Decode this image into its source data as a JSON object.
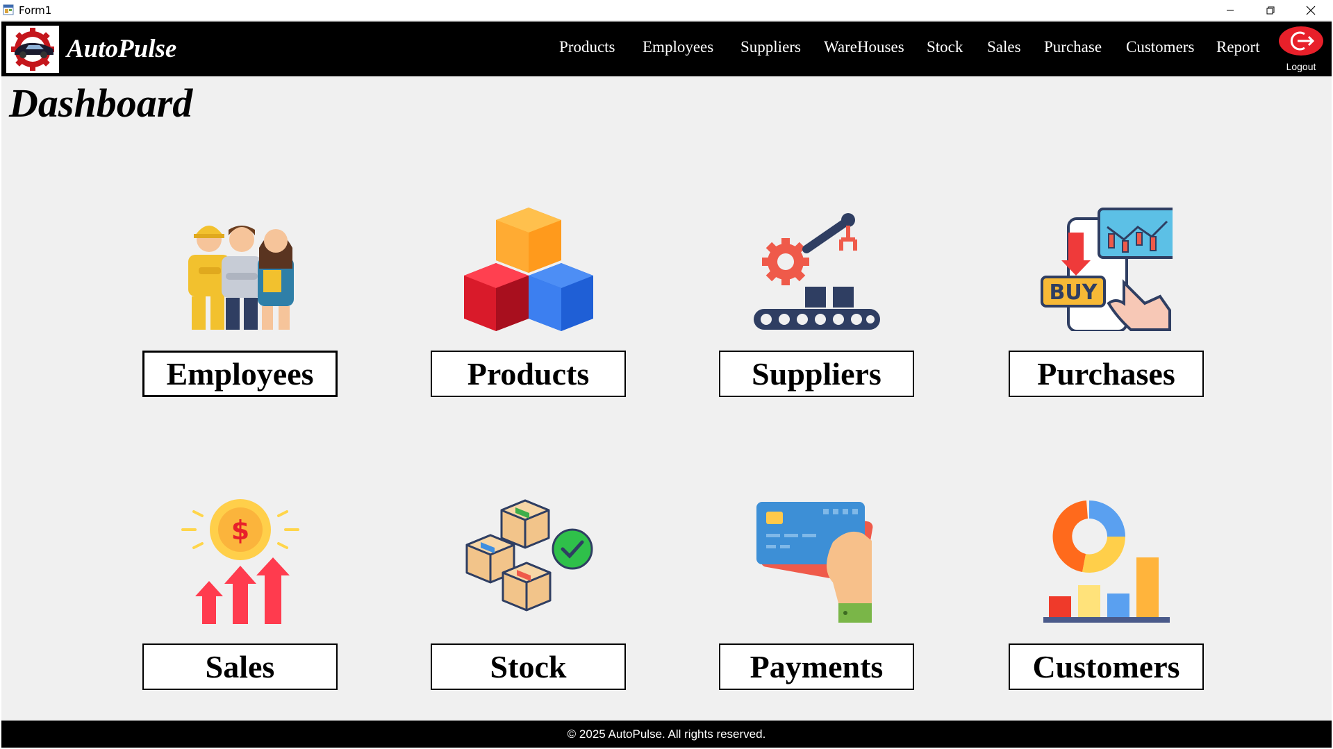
{
  "window": {
    "title": "Form1"
  },
  "navbar": {
    "brand": "AutoPulse",
    "links": [
      "Products",
      "Employees",
      "Suppliers",
      "WareHouses",
      "Stock",
      "Sales",
      "Purchase",
      "Customers",
      "Report"
    ],
    "logout_label": "Logout"
  },
  "page": {
    "title": "Dashboard"
  },
  "tiles": [
    {
      "label": "Employees",
      "icon": "employees-icon"
    },
    {
      "label": "Products",
      "icon": "products-cubes-icon"
    },
    {
      "label": "Suppliers",
      "icon": "suppliers-factory-icon"
    },
    {
      "label": "Purchases",
      "icon": "purchases-buy-icon"
    },
    {
      "label": "Sales",
      "icon": "sales-dollar-arrows-icon"
    },
    {
      "label": "Stock",
      "icon": "stock-boxes-icon"
    },
    {
      "label": "Payments",
      "icon": "payments-card-icon"
    },
    {
      "label": "Customers",
      "icon": "customers-chart-icon"
    }
  ],
  "footer": {
    "text": "© 2025 AutoPulse. All rights reserved."
  },
  "colors": {
    "navbar": "#000000",
    "background": "#f0f0f0",
    "logout": "#e8202a"
  }
}
